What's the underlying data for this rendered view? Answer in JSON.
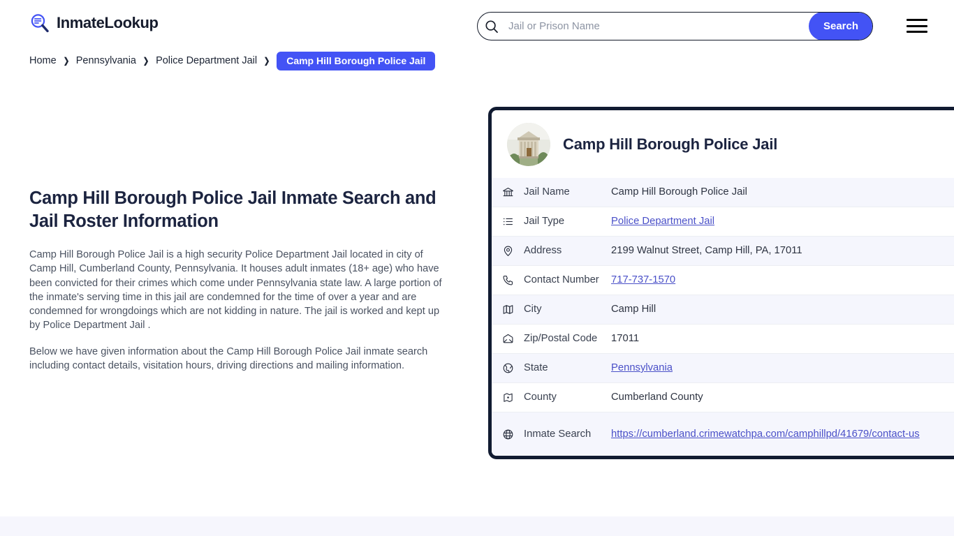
{
  "header": {
    "brand_name": "InmateLookup",
    "logo_icon": "magnifier-list-icon",
    "search": {
      "placeholder": "Jail or Prison Name",
      "value": "",
      "button_label": "Search",
      "icon": "search-icon"
    },
    "menu_icon": "hamburger-menu-icon"
  },
  "breadcrumb": {
    "items": [
      {
        "label": "Home",
        "current": false
      },
      {
        "label": "Pennsylvania",
        "current": false
      },
      {
        "label": "Police Department Jail",
        "current": false
      },
      {
        "label": "Camp Hill Borough Police Jail",
        "current": true
      }
    ],
    "separator": "❯"
  },
  "main": {
    "page_title": "Camp Hill Borough Police Jail Inmate Search and Jail Roster Information",
    "paragraphs": [
      "Camp Hill Borough Police Jail is a high security Police Department Jail located in city of Camp Hill, Cumberland County, Pennsylvania. It houses adult inmates (18+ age) who have been convicted for their crimes which come under Pennsylvania state law. A large portion of the inmate's serving time in this jail are condemned for the time of over a year and are condemned for wrongdoings which are not kidding in nature. The jail is worked and kept up by Police Department Jail .",
      "Below we have given information about the Camp Hill Borough Police Jail inmate search including contact details, visitation hours, driving directions and mailing information."
    ]
  },
  "card": {
    "photo_alt": "courthouse-building-photo",
    "title": "Camp Hill Borough Police Jail",
    "rows": [
      {
        "icon": "bank-building-icon",
        "label": "Jail Name",
        "value": "Camp Hill Borough Police Jail",
        "link": false
      },
      {
        "icon": "list-icon",
        "label": "Jail Type",
        "value": "Police Department Jail",
        "link": true
      },
      {
        "icon": "map-pin-icon",
        "label": "Address",
        "value": "2199 Walnut Street, Camp Hill, PA, 17011",
        "link": false
      },
      {
        "icon": "phone-icon",
        "label": "Contact Number",
        "value": "717-737-1570",
        "link": true
      },
      {
        "icon": "folded-map-icon",
        "label": "City",
        "value": "Camp Hill",
        "link": false
      },
      {
        "icon": "envelope-icon",
        "label": "Zip/Postal Code",
        "value": "17011",
        "link": false
      },
      {
        "icon": "globe-icon",
        "label": "State",
        "value": "Pennsylvania",
        "link": true
      },
      {
        "icon": "county-map-icon",
        "label": "County",
        "value": "Cumberland County",
        "link": false
      },
      {
        "icon": "web-globe-icon",
        "label": "Inmate Search",
        "value": "https://cumberland.crimewatchpa.com/camphillpd/41679/contact-us",
        "link": true
      }
    ]
  },
  "colors": {
    "accent_blue": "#4353f5",
    "link_blue": "#4a50c8",
    "dark_navy": "#111b31",
    "heading": "#1c2440",
    "row_stripe": "#f5f6fd",
    "body_text": "#4a5261"
  }
}
